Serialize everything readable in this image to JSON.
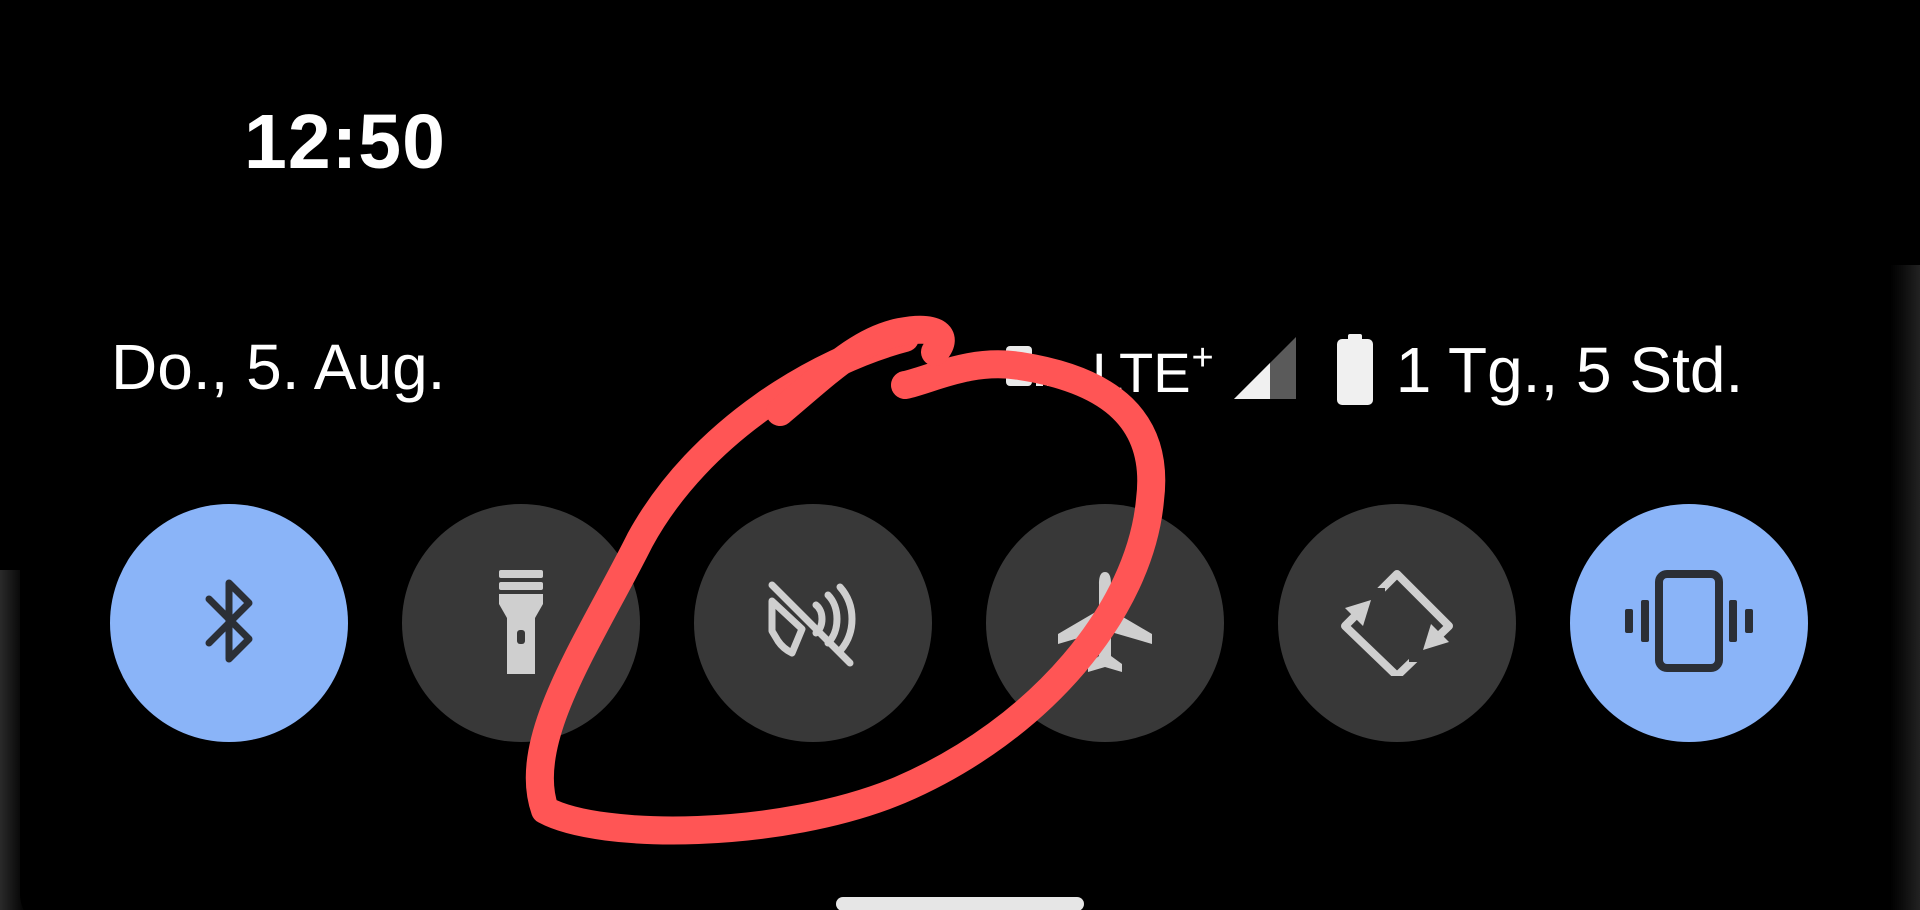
{
  "status_bar": {
    "time": "12:50"
  },
  "quick_settings": {
    "date": "Do., 5. Aug.",
    "network_type": "LTE",
    "network_type_plus": "+",
    "battery_estimate": "1 Tg., 5 Std.",
    "tiles": [
      {
        "name": "bluetooth",
        "icon": "bluetooth-icon",
        "state": "on"
      },
      {
        "name": "flashlight",
        "icon": "flashlight-icon",
        "state": "off"
      },
      {
        "name": "sound-muted",
        "icon": "mute-icon",
        "state": "off"
      },
      {
        "name": "airplane-mode",
        "icon": "airplane-icon",
        "state": "off"
      },
      {
        "name": "auto-rotate",
        "icon": "rotate-icon",
        "state": "off"
      },
      {
        "name": "vibrate",
        "icon": "vibrate-icon",
        "state": "on"
      }
    ],
    "colors": {
      "tile_on": "#8ab4f8",
      "tile_off": "#383838",
      "icon_on": "#2b2f36",
      "icon_off": "#cfcfcf",
      "annotation": "#ff5555"
    }
  }
}
